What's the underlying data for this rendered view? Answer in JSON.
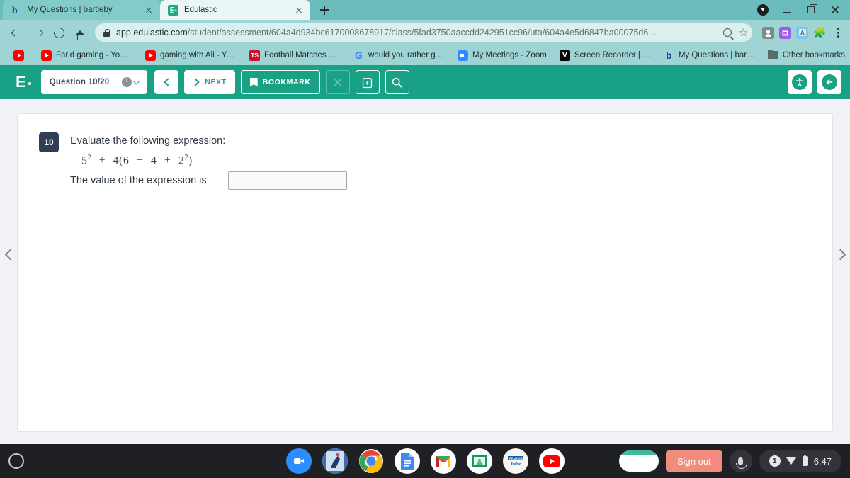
{
  "browser": {
    "tabs": [
      {
        "title": "My Questions | bartleby",
        "favicon": "bartleby-b-icon",
        "active": false
      },
      {
        "title": "Edulastic",
        "favicon": "edulastic-e-icon",
        "active": true
      }
    ],
    "new_tab_label": "+",
    "window_controls": [
      "download-indicator",
      "minimize",
      "maximize",
      "close"
    ],
    "omnibox": {
      "scheme_icon": "lock-icon",
      "host": "app.edulastic.com",
      "path": "/student/assessment/604a4d934bc6170008678917/class/5fad3750aaccdd242951cc96/uta/604a4e5d6847ba00075d6…"
    },
    "toolbar_icons": [
      "back-arrow",
      "forward-arrow",
      "reload",
      "home",
      "search-in-page",
      "bookmark-star",
      "extension-grey",
      "extension-purple",
      "extension-blue",
      "extensions-puzzle",
      "chrome-menu"
    ],
    "bookmarks": [
      {
        "label": "",
        "icon": "youtube-icon"
      },
      {
        "label": "Farid gaming - You…",
        "icon": "youtube-icon"
      },
      {
        "label": "gaming with Ali - Yo…",
        "icon": "youtube-icon"
      },
      {
        "label": "Football Matches Li…",
        "icon": "ts-icon"
      },
      {
        "label": "would you rather ga…",
        "icon": "google-icon"
      },
      {
        "label": "My Meetings - Zoom",
        "icon": "zoom-icon"
      },
      {
        "label": "Screen Recorder | V…",
        "icon": "vimeo-v-icon"
      },
      {
        "label": "My Questions | bart…",
        "icon": "bartleby-b-icon"
      }
    ],
    "other_bookmarks": {
      "label": "Other bookmarks",
      "icon": "folder-icon"
    }
  },
  "app": {
    "logo": "E",
    "question_pill": {
      "label": "Question 10/20",
      "status_icon": "warning-circle-icon",
      "chevron": "chevron-down-icon"
    },
    "buttons": {
      "prev": {
        "label": "",
        "icon": "chevron-left-icon"
      },
      "next": {
        "label": "NEXT",
        "icon": "chevron-right-icon"
      },
      "bookmark": {
        "label": "BOOKMARK",
        "icon": "bookmark-flag-icon"
      },
      "eliminate": {
        "label": "",
        "icon": "cross-icon",
        "disabled": true
      },
      "scratchpad": {
        "label": "",
        "icon": "scratchpad-icon"
      },
      "magnify": {
        "label": "",
        "icon": "magnifier-icon"
      }
    },
    "right_buttons": [
      {
        "name": "accessibility",
        "icon": "accessibility-icon",
        "glyph": "⚉"
      },
      {
        "name": "exit-test",
        "icon": "exit-arrow-icon",
        "glyph": "←"
      }
    ],
    "nav_arrows": {
      "left": "chevron-left-icon",
      "right": "chevron-right-icon"
    }
  },
  "question": {
    "number": "10",
    "prompt": "Evaluate the following expression:",
    "expression": {
      "term1_base": "5",
      "term1_exp": "2",
      "op1": "+",
      "coefficient": "4",
      "open_paren": "(",
      "inner1": "6",
      "op2": "+",
      "inner2": "4",
      "op3": "+",
      "inner3_base": "2",
      "inner3_exp": "2",
      "close_paren": ")"
    },
    "answer_label": "The value of the expression is",
    "answer_value": "",
    "answer_placeholder": ""
  },
  "shelf": {
    "launcher": "launcher-circle-icon",
    "apps": [
      {
        "name": "zoom",
        "icon": "zoom-icon",
        "active": false
      },
      {
        "name": "app-photo",
        "icon": "photo-app-icon",
        "active": false
      },
      {
        "name": "chrome",
        "icon": "chrome-icon",
        "active": true
      },
      {
        "name": "google-docs",
        "icon": "docs-icon",
        "active": false
      },
      {
        "name": "gmail",
        "icon": "gmail-icon",
        "active": false
      },
      {
        "name": "google-classroom",
        "icon": "classroom-icon",
        "active": false
      },
      {
        "name": "pearson-testnav",
        "icon": "testnav-icon",
        "active": false
      },
      {
        "name": "youtube",
        "icon": "youtube-icon",
        "active": false
      }
    ],
    "window_preview": "chrome-window-preview",
    "sign_out_label": "Sign out",
    "mic_icon": "microphone-icon",
    "tray": {
      "notification_count": "1",
      "wifi_icon": "wifi-icon",
      "battery_icon": "battery-icon",
      "time": "6:47"
    }
  },
  "colors": {
    "brand_teal": "#19a185",
    "chrome_theme": "#9ed4d4",
    "tab_strip": "#6bbdbd",
    "question_badge": "#2f3e52",
    "sign_out": "#f08b7e",
    "shelf": "#1f2023"
  }
}
